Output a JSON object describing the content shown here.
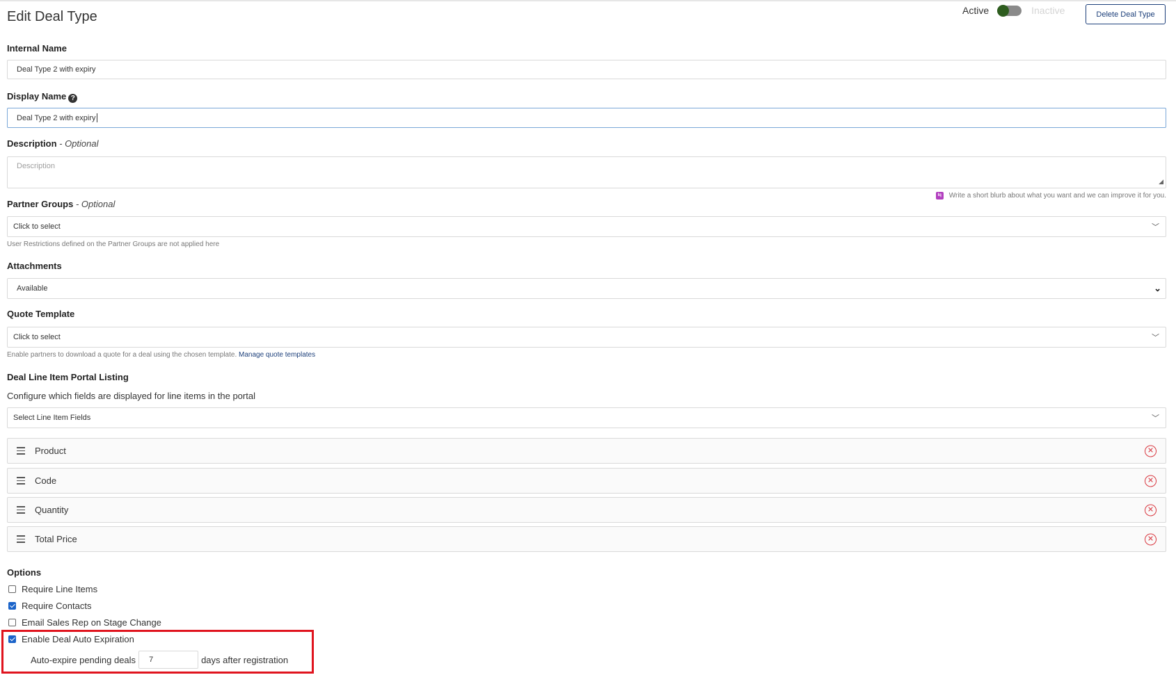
{
  "header": {
    "title": "Edit Deal Type",
    "active_label": "Active",
    "inactive_label": "Inactive",
    "delete_label": "Delete Deal Type"
  },
  "internal_name": {
    "label": "Internal Name",
    "value": "Deal Type 2 with expiry"
  },
  "display_name": {
    "label": "Display Name",
    "value": "Deal Type 2 with expiry"
  },
  "description": {
    "label": "Description",
    "optional": "- Optional",
    "placeholder": "Description",
    "ai_hint": "Write a short blurb about what you want and we can improve it for you."
  },
  "partner_groups": {
    "label": "Partner Groups",
    "optional": "- Optional",
    "placeholder": "Click to select",
    "hint": "User Restrictions defined on the Partner Groups are not applied here"
  },
  "attachments": {
    "label": "Attachments",
    "value": "Available"
  },
  "quote_template": {
    "label": "Quote Template",
    "placeholder": "Click to select",
    "hint": "Enable partners to download a quote for a deal using the chosen template.",
    "link": "Manage quote templates"
  },
  "line_item_listing": {
    "label": "Deal Line Item Portal Listing",
    "description": "Configure which fields are displayed for line items in the portal",
    "placeholder": "Select Line Item Fields",
    "items": [
      "Product",
      "Code",
      "Quantity",
      "Total Price"
    ]
  },
  "options": {
    "label": "Options",
    "items": [
      {
        "label": "Require Line Items",
        "checked": false
      },
      {
        "label": "Require Contacts",
        "checked": true
      },
      {
        "label": "Email Sales Rep on Stage Change",
        "checked": false
      },
      {
        "label": "Enable Deal Auto Expiration",
        "checked": true
      }
    ],
    "expire_prefix": "Auto-expire pending deals",
    "expire_days": "7",
    "expire_suffix": "days after registration"
  },
  "colors": {
    "accent": "#1c3f7a",
    "toggle_knob": "#2e5d1f",
    "remove": "#d9363e",
    "highlight": "#e0141e",
    "checkbox": "#1a63c9"
  }
}
